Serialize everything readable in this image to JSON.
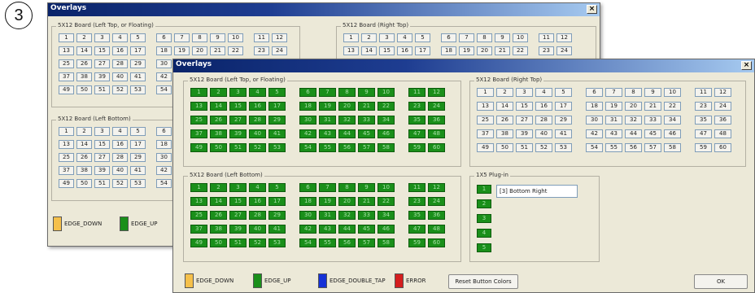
{
  "callout": "3",
  "back_window": {
    "title": "Overlays",
    "close_glyph": "×",
    "groups": {
      "left_top": "5X12 Board (Left Top, or Floating)",
      "right_top": "5X12 Board (Right Top)",
      "left_bottom": "5X12 Board (Left Bottom)"
    },
    "legend": [
      {
        "label": "EDGE_DOWN",
        "color": "#f5c04a"
      },
      {
        "label": "EDGE_UP",
        "color": "#1a8f1a"
      }
    ]
  },
  "front_window": {
    "title": "Overlays",
    "close_glyph": "×",
    "groups": {
      "left_top": "5X12 Board (Left Top, or Floating)",
      "right_top": "5X12 Board (Right Top)",
      "left_bottom": "5X12 Board (Left Bottom)",
      "plugin": "1X5 Plug-in"
    },
    "plugin_list_item": "[3] Bottom Right",
    "legend": [
      {
        "label": "EDGE_DOWN",
        "color": "#f5c04a"
      },
      {
        "label": "EDGE_UP",
        "color": "#1a8f1a"
      },
      {
        "label": "EDGE_DOUBLE_TAP",
        "color": "#1531d6"
      },
      {
        "label": "ERROR",
        "color": "#d41e1e"
      }
    ],
    "reset_button": "Reset Button Colors",
    "ok_button": "OK"
  },
  "board_rows": [
    [
      "1",
      "2",
      "3",
      "4",
      "5",
      "6",
      "7",
      "8",
      "9",
      "10",
      "11",
      "12"
    ],
    [
      "13",
      "14",
      "15",
      "16",
      "17",
      "18",
      "19",
      "20",
      "21",
      "22",
      "23",
      "24"
    ],
    [
      "25",
      "26",
      "27",
      "28",
      "29",
      "30",
      "31",
      "32",
      "33",
      "34",
      "35",
      "36"
    ],
    [
      "37",
      "38",
      "39",
      "40",
      "41",
      "42",
      "43",
      "44",
      "45",
      "46",
      "47",
      "48"
    ],
    [
      "49",
      "50",
      "51",
      "52",
      "53",
      "54",
      "55",
      "56",
      "57",
      "58",
      "59",
      "60"
    ]
  ],
  "plugin_buttons": [
    "1",
    "2",
    "3",
    "4",
    "5"
  ]
}
